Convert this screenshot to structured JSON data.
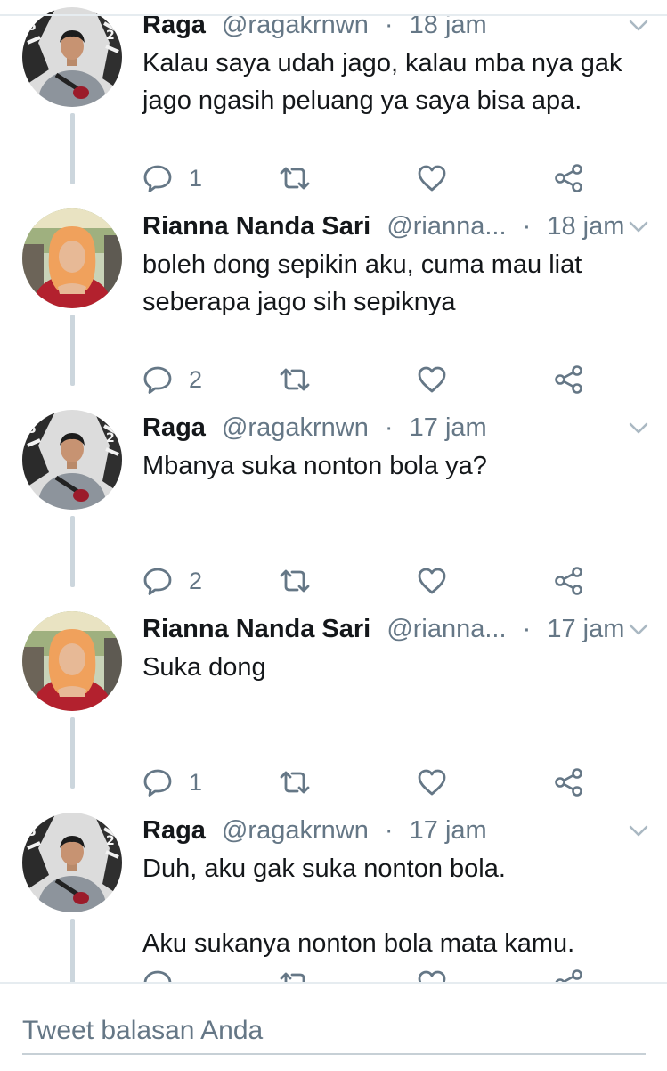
{
  "colors": {
    "text": "#14171a",
    "muted": "#657786",
    "thread_line": "#ccd6dd",
    "divider": "#e6ecf0"
  },
  "tweets": [
    {
      "name": "Raga",
      "handle": "@ragakrnwn",
      "separator": "·",
      "time": "18 jam",
      "lines": [
        "Kalau saya udah jago, kalau mba nya gak",
        "jago ngasih peluang ya saya bisa apa."
      ],
      "reply_count": "1",
      "avatar_icon": "raga-avatar"
    },
    {
      "name": "Rianna Nanda Sari",
      "handle": "@rianna...",
      "separator": "·",
      "time": "18 jam",
      "lines": [
        "boleh dong sepikin aku,  cuma mau liat",
        "seberapa jago sih sepiknya"
      ],
      "reply_count": "2",
      "avatar_icon": "rianna-avatar"
    },
    {
      "name": "Raga",
      "handle": "@ragakrnwn",
      "separator": "·",
      "time": "17 jam",
      "lines": [
        "Mbanya suka nonton bola ya?"
      ],
      "reply_count": "2",
      "avatar_icon": "raga-avatar"
    },
    {
      "name": "Rianna Nanda Sari",
      "handle": "@rianna...",
      "separator": "·",
      "time": "17 jam",
      "lines": [
        "Suka dong"
      ],
      "reply_count": "1",
      "avatar_icon": "rianna-avatar"
    },
    {
      "name": "Raga",
      "handle": "@ragakrnwn",
      "separator": "·",
      "time": "17 jam",
      "lines": [
        "Duh, aku gak suka nonton bola.",
        "",
        "Aku sukanya nonton bola mata kamu."
      ],
      "reply_count": "",
      "avatar_icon": "raga-avatar"
    }
  ],
  "reply_box": {
    "placeholder": "Tweet balasan Anda"
  }
}
